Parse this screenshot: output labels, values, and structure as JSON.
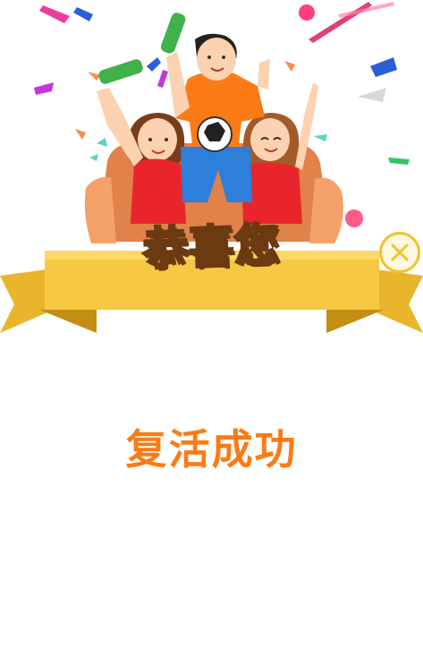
{
  "dialog": {
    "banner_text": "恭喜您",
    "status_text": "复活成功",
    "close_icon": "close-icon",
    "colors": {
      "banner": "#f7c843",
      "banner_dark": "#d9a21b",
      "status_text": "#fb7b16",
      "title_fill": "#ffd21e",
      "title_stroke": "#6b3a10"
    }
  }
}
